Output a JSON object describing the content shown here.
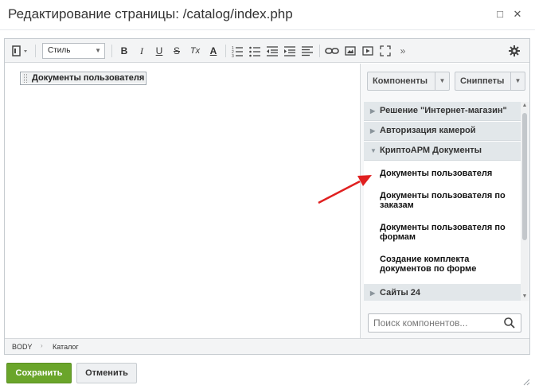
{
  "window": {
    "title": "Редактирование страницы: /catalog/index.php",
    "maximize_glyph": "□",
    "close_glyph": "✕"
  },
  "toolbar": {
    "style_select": "Стиль",
    "bold": "B",
    "italic": "I",
    "underline": "U",
    "strike": "S",
    "clear": "Tx",
    "font_color": "A",
    "more": "»"
  },
  "editor": {
    "component_block": "Документы пользователя"
  },
  "sidepanel": {
    "components_button": "Компоненты",
    "snippets_button": "Сниппеты",
    "groups": [
      {
        "label": "Решение \"Интернет-магазин\"",
        "expanded": false
      },
      {
        "label": "Авторизация камерой",
        "expanded": false
      },
      {
        "label": "КриптоАРМ Документы",
        "expanded": true
      },
      {
        "label": "Сайты 24",
        "expanded": false
      }
    ],
    "items": [
      {
        "line1": "Документы пользователя",
        "line2": ""
      },
      {
        "line1": "Документы пользователя по",
        "line2": "заказам"
      },
      {
        "line1": "Документы пользователя по",
        "line2": "формам"
      },
      {
        "line1": "Создание комплекта",
        "line2": "документов по форме"
      }
    ],
    "search_placeholder": "Поиск компонентов..."
  },
  "statusbar": {
    "crumbs": [
      "BODY",
      "Каталог"
    ]
  },
  "footer": {
    "save_label": "Сохранить",
    "cancel_label": "Отменить"
  },
  "colors": {
    "save_button": "#6aa52a",
    "annotation_arrow": "#e02020",
    "group_header": "#e2e7ea"
  },
  "icons": [
    "view-mode-icon",
    "bold-icon",
    "italic-icon",
    "underline-icon",
    "strikethrough-icon",
    "clear-format-icon",
    "font-color-icon",
    "ordered-list-icon",
    "unordered-list-icon",
    "outdent-icon",
    "indent-icon",
    "align-icon",
    "link-icon",
    "image-icon",
    "video-icon",
    "fullscreen-icon",
    "more-icon",
    "settings-gear-icon",
    "search-icon",
    "resize-grip-icon"
  ]
}
